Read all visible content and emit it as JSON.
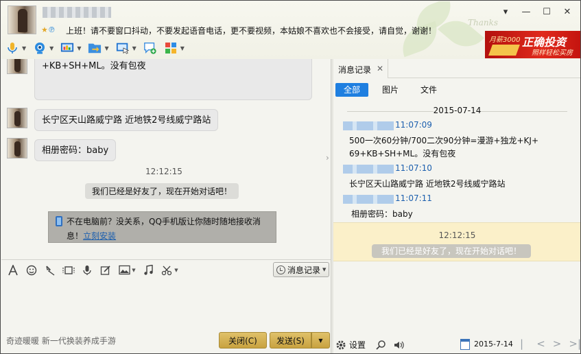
{
  "header": {
    "signature": "上班！请不要窗口抖动，不要发起语音电话，更不要视频，本姑娘不喜欢也不会接受，请自觉，谢谢！",
    "deco_text": "Thanks",
    "window_controls": [
      "▾",
      "—",
      "☐",
      "✕"
    ]
  },
  "ad": {
    "line1": "月薪3000",
    "line2": "正确投资",
    "line3": "照样轻松买房"
  },
  "toolbar": {
    "icons": [
      "microphone-icon",
      "webcam-icon",
      "remote-desktop-icon",
      "file-transfer-icon",
      "screen-share-icon",
      "invite-icon",
      "apps-icon"
    ]
  },
  "chat": {
    "messages": [
      {
        "text": "+KB+SH+ML。没有包夜"
      },
      {
        "text": "长宁区天山路威宁路  近地铁2号线威宁路站"
      },
      {
        "text": "相册密码：baby"
      }
    ],
    "time": "12:12:15",
    "system_notice": "我们已经是好友了，现在开始对话吧！",
    "promo_text": "不在电脑前？没关系，QQ手机版让你随时随地接收消息！",
    "promo_link": "立刻安装"
  },
  "input_toolbar": {
    "icons": [
      "font-icon",
      "emoji-icon",
      "nudge-icon",
      "gif-icon",
      "voice-message-icon",
      "doodle-icon",
      "image-icon",
      "music-icon",
      "screenshot-icon"
    ],
    "history_label": "消息记录"
  },
  "footer": {
    "status_text": "奇迹暖暖 新一代换装养成手游",
    "close_label": "关闭(C)",
    "send_label": "发送(S)"
  },
  "history": {
    "tab_label": "消息记录",
    "filters": [
      "全部",
      "图片",
      "文件"
    ],
    "date": "2015-07-14",
    "entries": [
      {
        "time": "11:07:09",
        "text_lines": [
          "500一次60分钟/700二次90分钟=漫游+独龙+KJ+",
          "69+KB+SH+ML。没有包夜"
        ]
      },
      {
        "time": "11:07:10",
        "text_lines": [
          "长宁区天山路威宁路  近地铁2号线威宁路站"
        ]
      },
      {
        "time": "11:07:11",
        "text_lines": [
          "相册密码：baby"
        ]
      }
    ],
    "highlight_time": "12:12:15",
    "highlight_text": "我们已经是好友了，现在开始对话吧！",
    "settings_label": "设置",
    "date_input": "2015-7-14",
    "pager": [
      "|<",
      "<",
      ">",
      ">|"
    ]
  },
  "colors": {
    "accent": "#1f7fe0",
    "button_gold": "#d4b050",
    "highlight": "#fbf0c9"
  }
}
